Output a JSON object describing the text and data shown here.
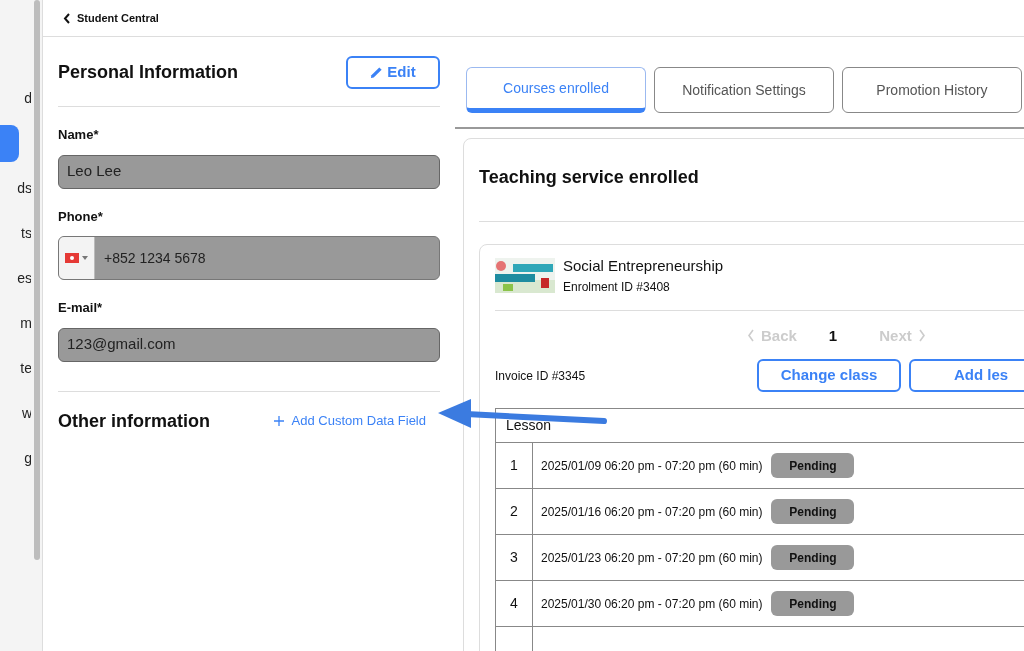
{
  "sidebar": {
    "items": [
      {
        "label": "d",
        "selected": false
      },
      {
        "selected": true
      },
      {
        "label": "ds",
        "selected": false
      },
      {
        "label": "ts",
        "selected": false
      },
      {
        "label": "es",
        "selected": false
      },
      {
        "label": "m",
        "selected": false
      },
      {
        "label": "te",
        "selected": false
      },
      {
        "label": "w",
        "selected": false
      },
      {
        "label": "g",
        "selected": false
      }
    ]
  },
  "header": {
    "back_label": "Student Central"
  },
  "personal_information": {
    "title": "Personal Information",
    "edit_button": "Edit",
    "fields": [
      {
        "label": "Name*",
        "kind": "text",
        "value": "Leo Lee"
      },
      {
        "label": "Phone*",
        "kind": "phone",
        "value": "+852 1234 5678"
      },
      {
        "label": "E-mail*",
        "kind": "text",
        "value": "123@gmail.com"
      }
    ]
  },
  "other_information": {
    "title": "Other information",
    "add_link": "Add Custom Data Field"
  },
  "tabs": [
    {
      "label": "Courses enrolled",
      "selected": true
    },
    {
      "label": "Notification Settings",
      "selected": false
    },
    {
      "label": "Promotion History",
      "selected": false
    }
  ],
  "teaching_service": {
    "title": "Teaching service enrolled",
    "course": {
      "name": "Social Entrepreneurship",
      "enrolment_id": "Enrolment ID #3408"
    },
    "pagination": {
      "back": "Back",
      "page": "1",
      "next": "Next"
    },
    "invoice_id": "Invoice ID #3345",
    "buttons": [
      "Change class",
      "Add les"
    ],
    "table": {
      "columns": [
        "Lesson"
      ],
      "rows": [
        {
          "number": "1",
          "time": "2025/01/09 06:20 pm - 07:20 pm (60 min)",
          "status": "Pending"
        },
        {
          "number": "2",
          "time": "2025/01/16 06:20 pm - 07:20 pm (60 min)",
          "status": "Pending"
        },
        {
          "number": "3",
          "time": "2025/01/23 06:20 pm - 07:20 pm (60 min)",
          "status": "Pending"
        },
        {
          "number": "4",
          "time": "2025/01/30 06:20 pm - 07:20 pm (60 min)",
          "status": "Pending"
        }
      ]
    }
  }
}
